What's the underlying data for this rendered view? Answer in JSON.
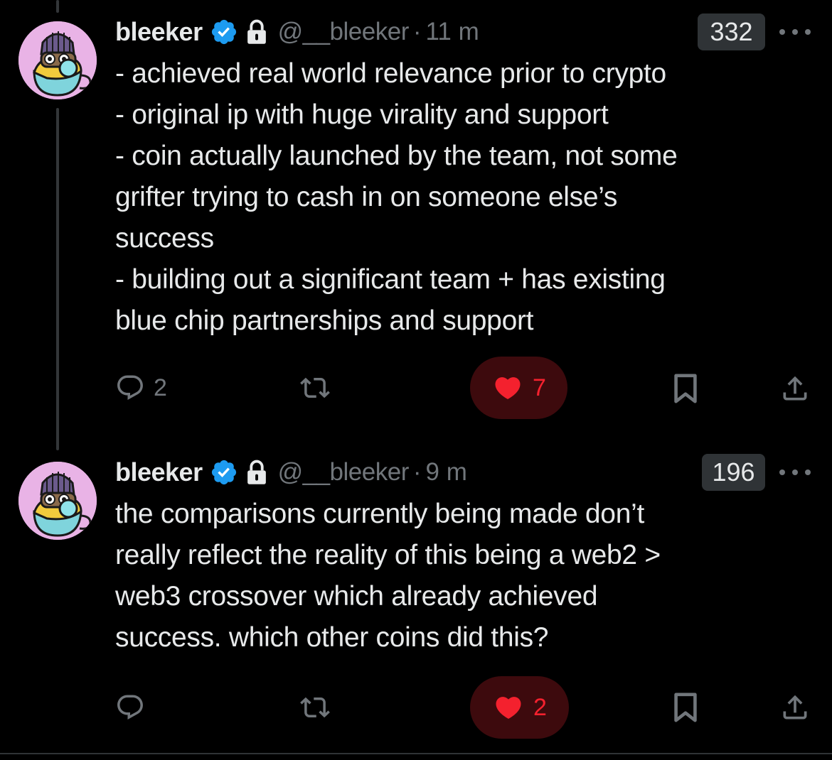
{
  "colors": {
    "background": "#000000",
    "text": "#e7e9ea",
    "muted": "#71767b",
    "verified_blue": "#1d9bf0",
    "like_red": "#f4212e",
    "like_pill_bg": "#3d0a0d",
    "badge_bg": "#2f3336",
    "avatar_bg": "#e9b3e6"
  },
  "tweets": [
    {
      "name": "bleeker",
      "handle": "@__bleeker",
      "separator": "·",
      "time": "11 m",
      "badge_count": "332",
      "icons": [
        "verified-badge-icon",
        "lock-icon",
        "more-options-icon"
      ],
      "lines": [
        "- achieved real world relevance prior to crypto",
        "- original ip with huge virality and support",
        "- coin actually launched by the team, not some",
        "grifter trying to cash in on someone else’s",
        "success",
        "- building out a significant team + has existing",
        "blue chip partnerships and support"
      ],
      "actions": {
        "reply_count": "2",
        "repost_count": "",
        "like_count": "7",
        "liked": true
      }
    },
    {
      "name": "bleeker",
      "handle": "@__bleeker",
      "separator": "·",
      "time": "9 m",
      "badge_count": "196",
      "icons": [
        "verified-badge-icon",
        "lock-icon",
        "more-options-icon"
      ],
      "lines": [
        "the comparisons currently being made don’t",
        "really reflect the reality of this being a web2 >",
        "web3 crossover which already achieved",
        "success. which other coins did this?"
      ],
      "actions": {
        "reply_count": "",
        "repost_count": "",
        "like_count": "2",
        "liked": true
      }
    }
  ]
}
